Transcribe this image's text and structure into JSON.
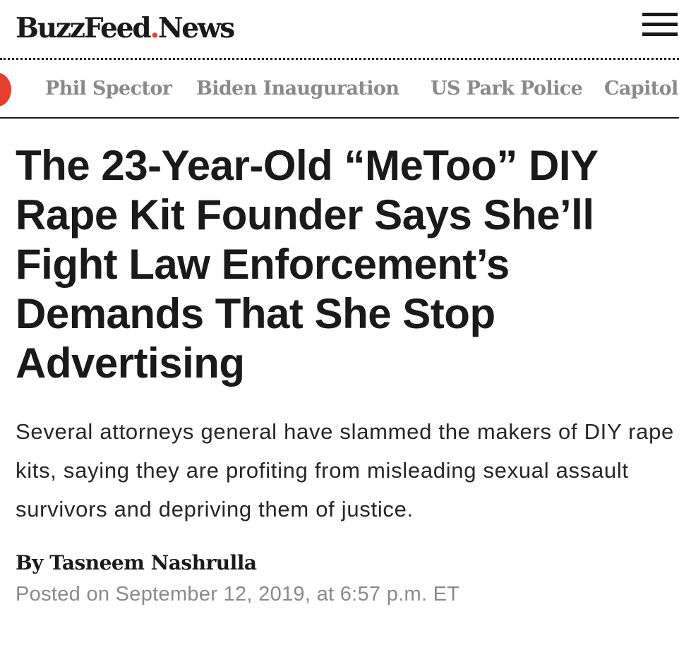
{
  "header": {
    "logo_main": "BuzzFeed",
    "logo_dot": ".",
    "logo_sub": "News",
    "menu_icon": "hamburger-menu-icon"
  },
  "colors": {
    "brand_red": "#e53f2e",
    "text_dark": "#1a1a1a",
    "text_gray": "#8a8a8a"
  },
  "topics": {
    "items": [
      {
        "label": "Phil Spector"
      },
      {
        "label": "Biden Inauguration"
      },
      {
        "label": "US Park Police"
      },
      {
        "label": "Capitol"
      }
    ]
  },
  "article": {
    "headline": "The 23-Year-Old “MeToo” DIY Rape Kit Founder Says She’ll Fight Law Enforcement’s Demands That She Stop Advertising",
    "dek": "Several attorneys general have slammed the makers of DIY rape kits, saying they are profiting from misleading sexual assault survivors and depriving them of justice.",
    "byline": "By Tasneem Nashrulla",
    "timestamp": "Posted on September 12, 2019, at 6:57 p.m. ET"
  }
}
